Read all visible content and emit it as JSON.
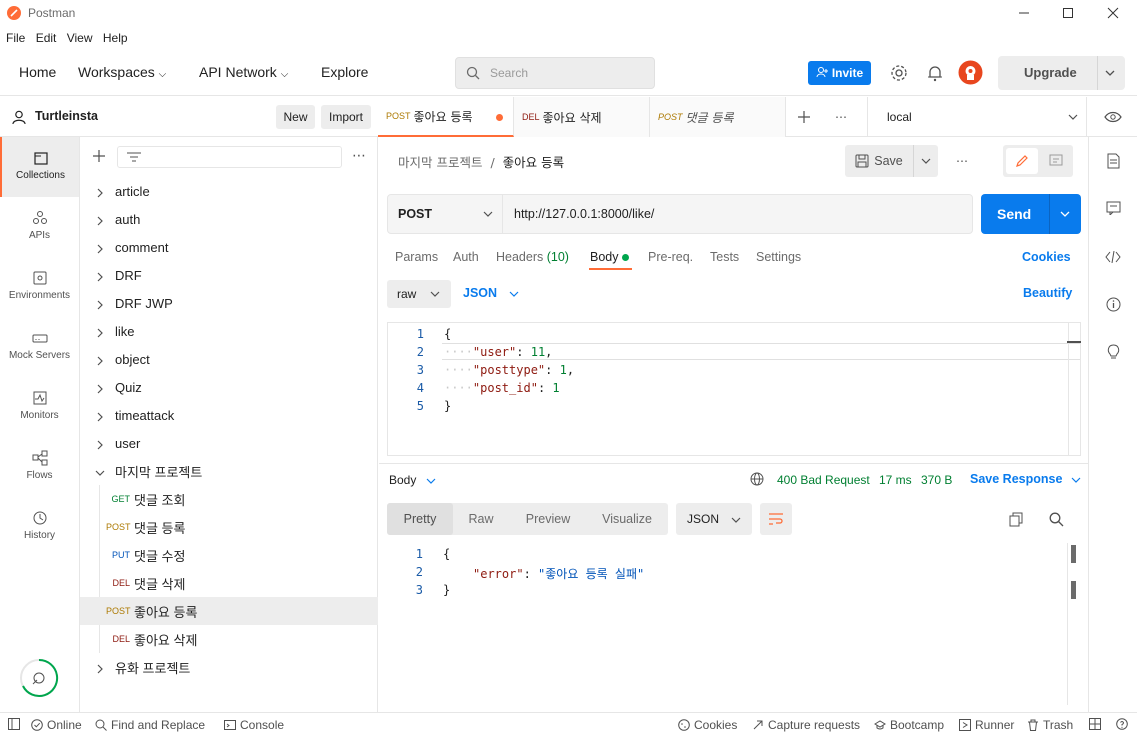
{
  "window": {
    "title": "Postman"
  },
  "menu": [
    "File",
    "Edit",
    "View",
    "Help"
  ],
  "nav": {
    "home": "Home",
    "workspaces": "Workspaces",
    "api_network": "API Network",
    "explore": "Explore",
    "search_placeholder": "Search",
    "invite": "Invite",
    "upgrade": "Upgrade"
  },
  "sidebar": {
    "workspace": "Turtleinsta",
    "new": "New",
    "import": "Import",
    "rail": [
      "Collections",
      "APIs",
      "Environments",
      "Mock Servers",
      "Monitors",
      "Flows",
      "History"
    ],
    "collections": [
      "article",
      "auth",
      "comment",
      "DRF",
      "DRF JWP",
      "like",
      "object",
      "Quiz",
      "timeattack",
      "user"
    ],
    "open_collection": "마지막 프로젝트",
    "requests": [
      {
        "method": "GET",
        "name": "댓글 조회"
      },
      {
        "method": "POST",
        "name": "댓글 등록"
      },
      {
        "method": "PUT",
        "name": "댓글 수정"
      },
      {
        "method": "DEL",
        "name": "댓글 삭제"
      },
      {
        "method": "POST",
        "name": "좋아요 등록"
      },
      {
        "method": "DEL",
        "name": "좋아요 삭제"
      }
    ],
    "last_collection": "유화 프로젝트"
  },
  "tabs": [
    {
      "method": "POST",
      "name": "좋아요 등록"
    },
    {
      "method": "DEL",
      "name": "좋아요 삭제"
    },
    {
      "method": "POST",
      "name": "댓글 등록"
    }
  ],
  "environment": "local",
  "breadcrumb": {
    "parent": "마지막 프로젝트",
    "sep": "/",
    "current": "좋아요 등록"
  },
  "save": "Save",
  "request": {
    "method": "POST",
    "url": "http://127.0.0.1:8000/like/",
    "send": "Send"
  },
  "request_tabs": {
    "params": "Params",
    "auth": "Auth",
    "headers": "Headers",
    "headers_count": "(10)",
    "body": "Body",
    "prereq": "Pre-req.",
    "tests": "Tests",
    "settings": "Settings",
    "cookies": "Cookies"
  },
  "body_opts": {
    "mode": "raw",
    "lang": "JSON",
    "beautify": "Beautify"
  },
  "body_lines": [
    "1",
    "2",
    "3",
    "4",
    "5"
  ],
  "body_code": {
    "k1": "\"user\"",
    "v1": "11",
    "k2": "\"posttype\"",
    "v2": "1",
    "k3": "\"post_id\"",
    "v3": "1"
  },
  "response": {
    "label": "Body",
    "status": "400 Bad Request",
    "time": "17 ms",
    "size": "370 B",
    "save": "Save Response",
    "views": [
      "Pretty",
      "Raw",
      "Preview",
      "Visualize"
    ],
    "format": "JSON",
    "lines": [
      "1",
      "2",
      "3"
    ],
    "key": "\"error\"",
    "value": "\"좋아요 등록 실패\""
  },
  "status_bar": {
    "online": "Online",
    "find": "Find and Replace",
    "console": "Console",
    "cookies": "Cookies",
    "capture": "Capture requests",
    "bootcamp": "Bootcamp",
    "runner": "Runner",
    "trash": "Trash"
  },
  "colors": {
    "accent": "#ff6c37",
    "blue": "#097bed",
    "green": "#007f31",
    "get": "#007f31",
    "post": "#ad7a03",
    "put": "#0053b8",
    "del": "#8e1a10"
  }
}
